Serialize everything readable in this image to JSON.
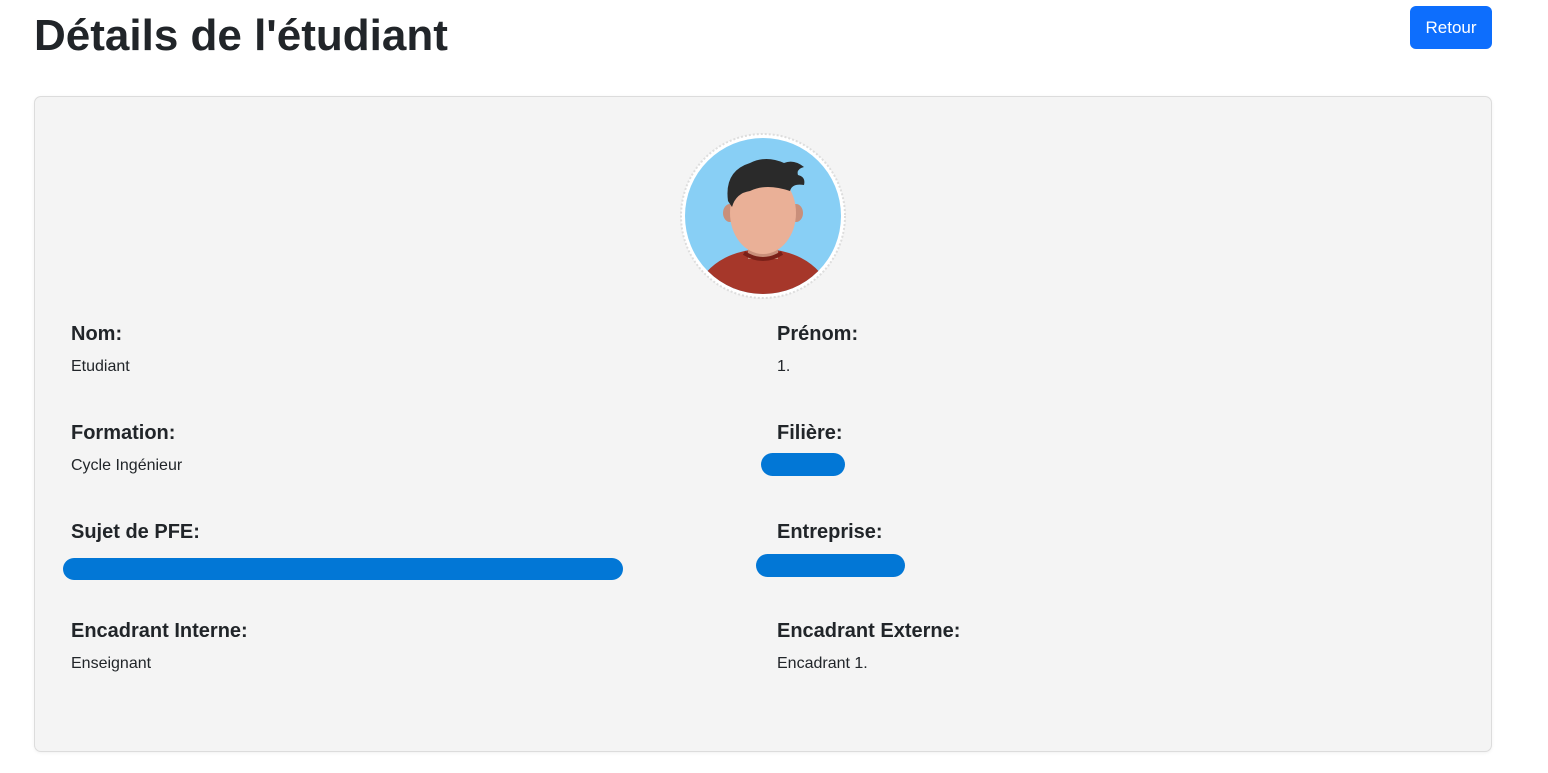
{
  "header": {
    "title": "Détails de l'étudiant",
    "back_label": "Retour"
  },
  "profile": {
    "avatar_icon": "student-avatar-icon",
    "fields": {
      "nom": {
        "label": "Nom:",
        "value": "Etudiant"
      },
      "prenom": {
        "label": "Prénom:",
        "value": "1."
      },
      "formation": {
        "label": "Formation:",
        "value": "Cycle Ingénieur"
      },
      "filiere": {
        "label": "Filière:",
        "value": ""
      },
      "sujet": {
        "label": "Sujet de PFE:",
        "value": ""
      },
      "entreprise": {
        "label": "Entreprise:",
        "value": ""
      },
      "encadrant_interne": {
        "label": "Encadrant Interne:",
        "value": "Enseignant"
      },
      "encadrant_externe": {
        "label": "Encadrant Externe:",
        "value": "Encadrant 1."
      }
    }
  },
  "colors": {
    "primary": "#0d6efd",
    "redaction": "#0277d6",
    "card_background": "#f4f4f4"
  }
}
